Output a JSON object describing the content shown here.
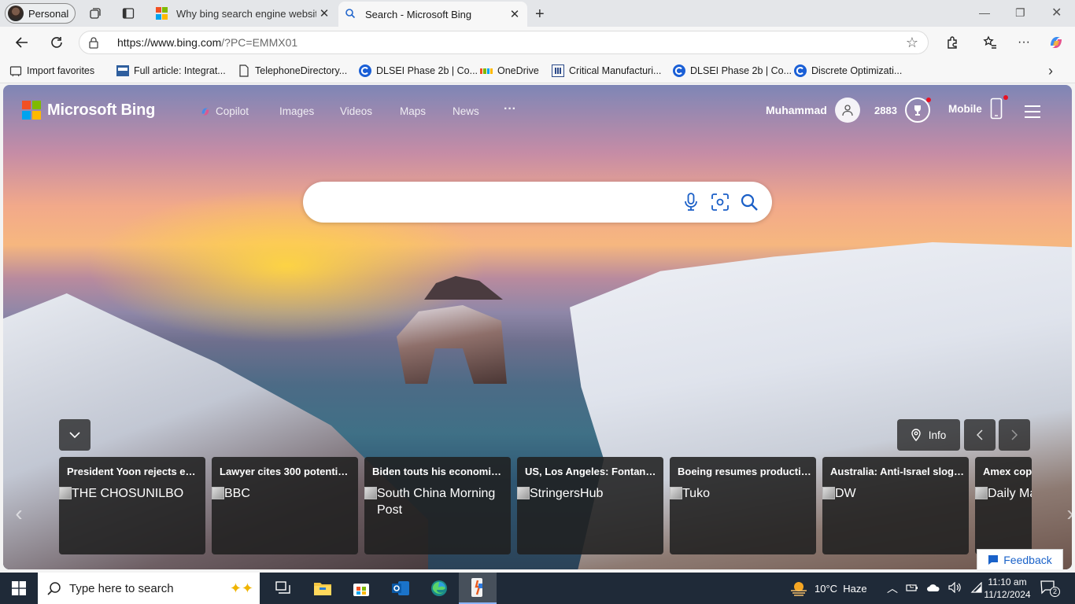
{
  "browser": {
    "profile_label": "Personal",
    "tabs": [
      {
        "title": "Why bing search engine website i",
        "active": false
      },
      {
        "title": "Search - Microsoft Bing",
        "active": true
      }
    ],
    "url_main": "https://www.bing.com",
    "url_rest": "/?PC=EMMX01",
    "bookmarks": [
      {
        "label": "Import favorites",
        "icon": "import-icon"
      },
      {
        "label": "Full article: Integrat...",
        "icon": "article-icon"
      },
      {
        "label": "TelephoneDirectory...",
        "icon": "document-icon"
      },
      {
        "label": "DLSEI Phase 2b | Co...",
        "icon": "c-circle-icon"
      },
      {
        "label": "OneDrive",
        "icon": "microsoft-logo-icon"
      },
      {
        "label": "Critical Manufacturi...",
        "icon": "bars-icon"
      },
      {
        "label": "DLSEI Phase 2b | Co...",
        "icon": "c-circle-icon"
      },
      {
        "label": "Discrete Optimizati...",
        "icon": "c-circle-icon"
      }
    ]
  },
  "bing": {
    "logo_text": "Microsoft Bing",
    "nav": [
      "Copilot",
      "Images",
      "Videos",
      "Maps",
      "News",
      "···"
    ],
    "user_name": "Muhammad",
    "rewards_points": "2883",
    "mobile_label": "Mobile",
    "search_placeholder": "",
    "info_label": "Info",
    "feedback_label": "Feedback",
    "news": [
      {
        "title": "President Yoon rejects earl...",
        "source": "THE CHOSUNILBO"
      },
      {
        "title": "Lawyer cites 300 potential ...",
        "source": "BBC"
      },
      {
        "title": "Biden touts his economic l...",
        "source": "South China Morning Post"
      },
      {
        "title": "US, Los Angeles: Fontana H...",
        "source": "StringersHub"
      },
      {
        "title": "Boeing resumes productio...",
        "source": "Tuko"
      },
      {
        "title": "Australia: Anti-Israel slogan...",
        "source": "DW"
      },
      {
        "title": "Amex copi",
        "source": "Daily Ma"
      }
    ]
  },
  "taskbar": {
    "search_placeholder": "Type here to search",
    "weather": "10°C  Haze",
    "time": "11:10 am",
    "date": "11/12/2024",
    "notifications": "2"
  },
  "colors": {
    "bing_red": "#f25022",
    "bing_green": "#7fba00",
    "bing_blue": "#00a4ef",
    "bing_yellow": "#ffb900",
    "feedback_blue": "#1a62c9",
    "taskbar": "#1f2a38"
  }
}
